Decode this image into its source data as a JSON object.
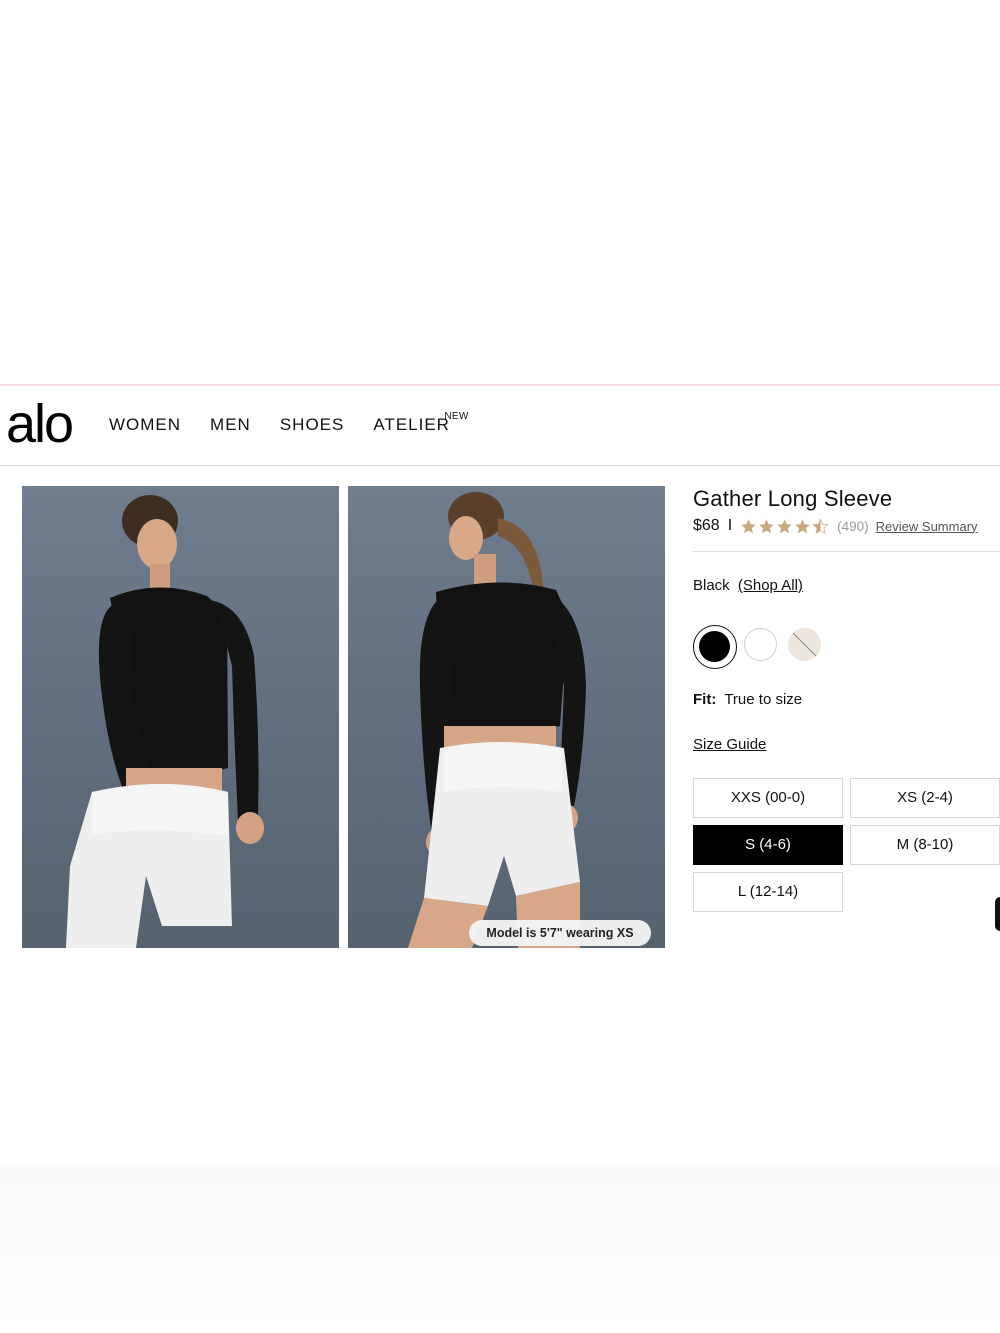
{
  "header": {
    "logo": "alo",
    "nav": [
      {
        "label": "WOMEN"
      },
      {
        "label": "MEN"
      },
      {
        "label": "SHOES"
      },
      {
        "label": "ATELIER",
        "badge": "NEW"
      }
    ]
  },
  "gallery": {
    "caption": "Model is 5'7\" wearing XS"
  },
  "product": {
    "title": "Gather Long Sleeve",
    "price": "$68",
    "separator": "I",
    "rating": 4.5,
    "review_count": "(490)",
    "review_link": "Review Summary",
    "color_label": "Black",
    "color_link": "(Shop All)",
    "swatches": [
      {
        "name": "black",
        "color": "#000000",
        "selected": true
      },
      {
        "name": "white",
        "color": "#ffffff",
        "selected": false
      },
      {
        "name": "ivory",
        "color": "#ece6dc",
        "selected": false
      }
    ],
    "fit_label": "Fit:",
    "fit_value": "True to size",
    "size_guide": "Size Guide",
    "sizes": [
      {
        "label": "XXS (00-0)",
        "selected": false
      },
      {
        "label": "XS (2-4)",
        "selected": false
      },
      {
        "label": "S (4-6)",
        "selected": true
      },
      {
        "label": "M (8-10)",
        "selected": false
      },
      {
        "label": "L (12-14)",
        "selected": false
      }
    ]
  },
  "colors": {
    "star": "#c8a97e",
    "accent": "#000000",
    "pink_rule": "#f6d9de"
  }
}
